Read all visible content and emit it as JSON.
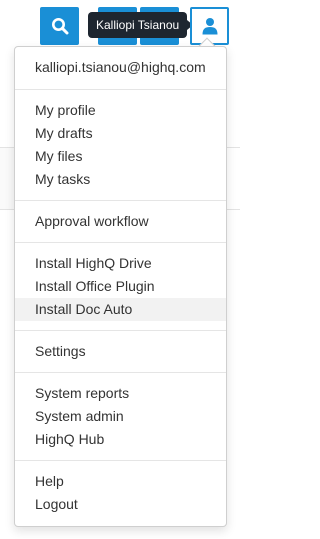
{
  "header": {
    "tooltip": "Kalliopi Tsianou",
    "icons": [
      "search-icon",
      "user-icon"
    ],
    "accent_color": "#1a8fd6"
  },
  "menu": {
    "email": "kalliopi.tsianou@highq.com",
    "profile_group": [
      "My profile",
      "My drafts",
      "My files",
      "My tasks"
    ],
    "approval_group": [
      "Approval workflow"
    ],
    "install_group": [
      "Install HighQ Drive",
      "Install Office Plugin",
      "Install Doc Auto"
    ],
    "settings_group": [
      "Settings"
    ],
    "system_group": [
      "System reports",
      "System admin",
      "HighQ Hub"
    ],
    "help_group": [
      "Help",
      "Logout"
    ],
    "highlighted_item": "Install Doc Auto"
  }
}
